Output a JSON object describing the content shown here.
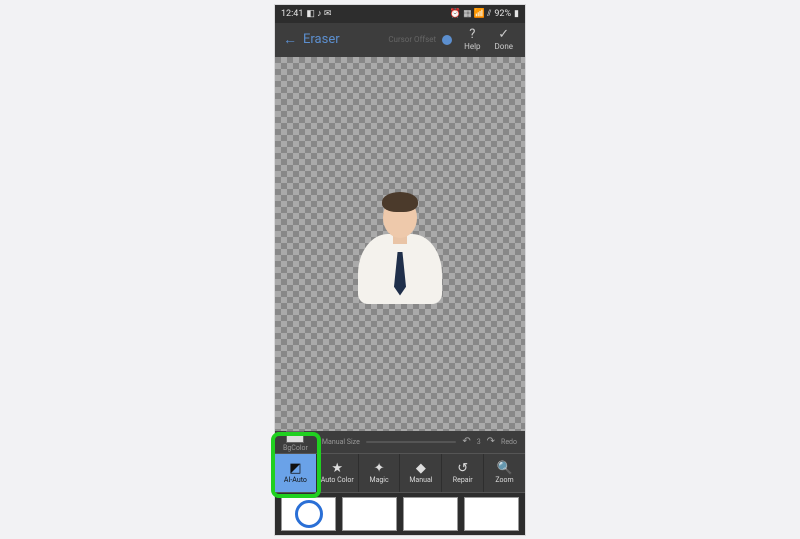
{
  "status": {
    "time": "12:41",
    "left_icons": "◧ ♪ ✉",
    "right_icons": "⏰ ▦ 📶 ⫽",
    "battery": "92%"
  },
  "topbar": {
    "title": "Eraser",
    "cursor_offset_label": "Cursor Offset",
    "help_label": "Help",
    "done_label": "Done"
  },
  "subbar": {
    "bgcolor_label": "BgColor",
    "manual_size_label": "Manual Size",
    "undo_count": "3",
    "redo_label": "Redo"
  },
  "tools": [
    {
      "id": "ai-auto",
      "label": "AI-Auto",
      "icon": "◩",
      "active": true
    },
    {
      "id": "auto-color",
      "label": "Auto Color",
      "icon": "★",
      "active": false
    },
    {
      "id": "magic",
      "label": "Magic",
      "icon": "✦",
      "active": false
    },
    {
      "id": "manual",
      "label": "Manual",
      "icon": "◆",
      "active": false
    },
    {
      "id": "repair",
      "label": "Repair",
      "icon": "↺",
      "active": false
    },
    {
      "id": "zoom",
      "label": "Zoom",
      "icon": "🔍",
      "active": false
    }
  ],
  "thumbs": [
    {
      "kind": "ring"
    },
    {
      "kind": "blank"
    },
    {
      "kind": "blank"
    },
    {
      "kind": "blank"
    }
  ]
}
